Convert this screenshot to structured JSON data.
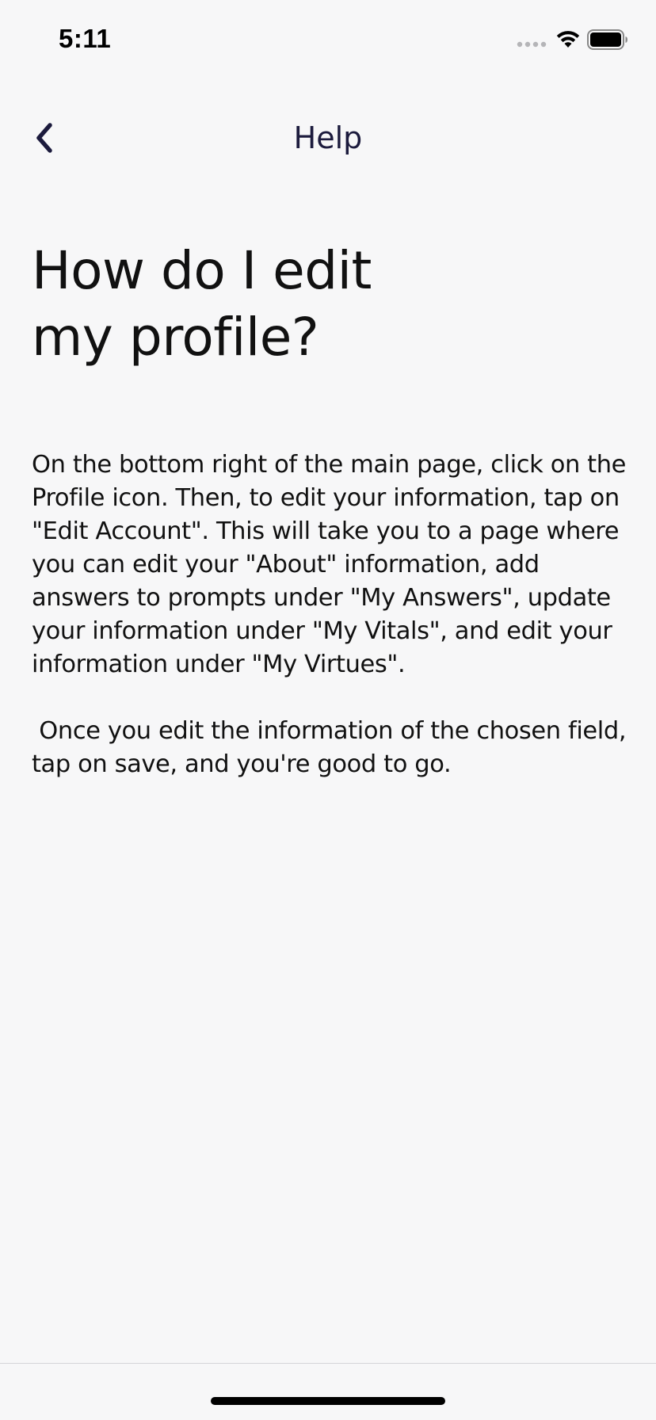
{
  "status_bar": {
    "time": "5:11"
  },
  "nav": {
    "title": "Help",
    "back_icon": "chevron-left-icon"
  },
  "article": {
    "title_line1": "How do I edit",
    "title_line2": "my profile?",
    "paragraph1": "On the bottom right of the main page, click on the Profile icon. Then, to edit your information, tap on \"Edit Account\". This will take you to a page where you can edit your \"About\" information, add answers to prompts under \"My Answers\", update your information under \"My Vitals\",  and edit your information under \"My Virtues\".",
    "paragraph2": " Once you edit the information of the chosen field, tap on save, and you're good to go."
  },
  "colors": {
    "background": "#f7f7f8",
    "nav_title": "#1c1b3d",
    "text": "#111111"
  }
}
